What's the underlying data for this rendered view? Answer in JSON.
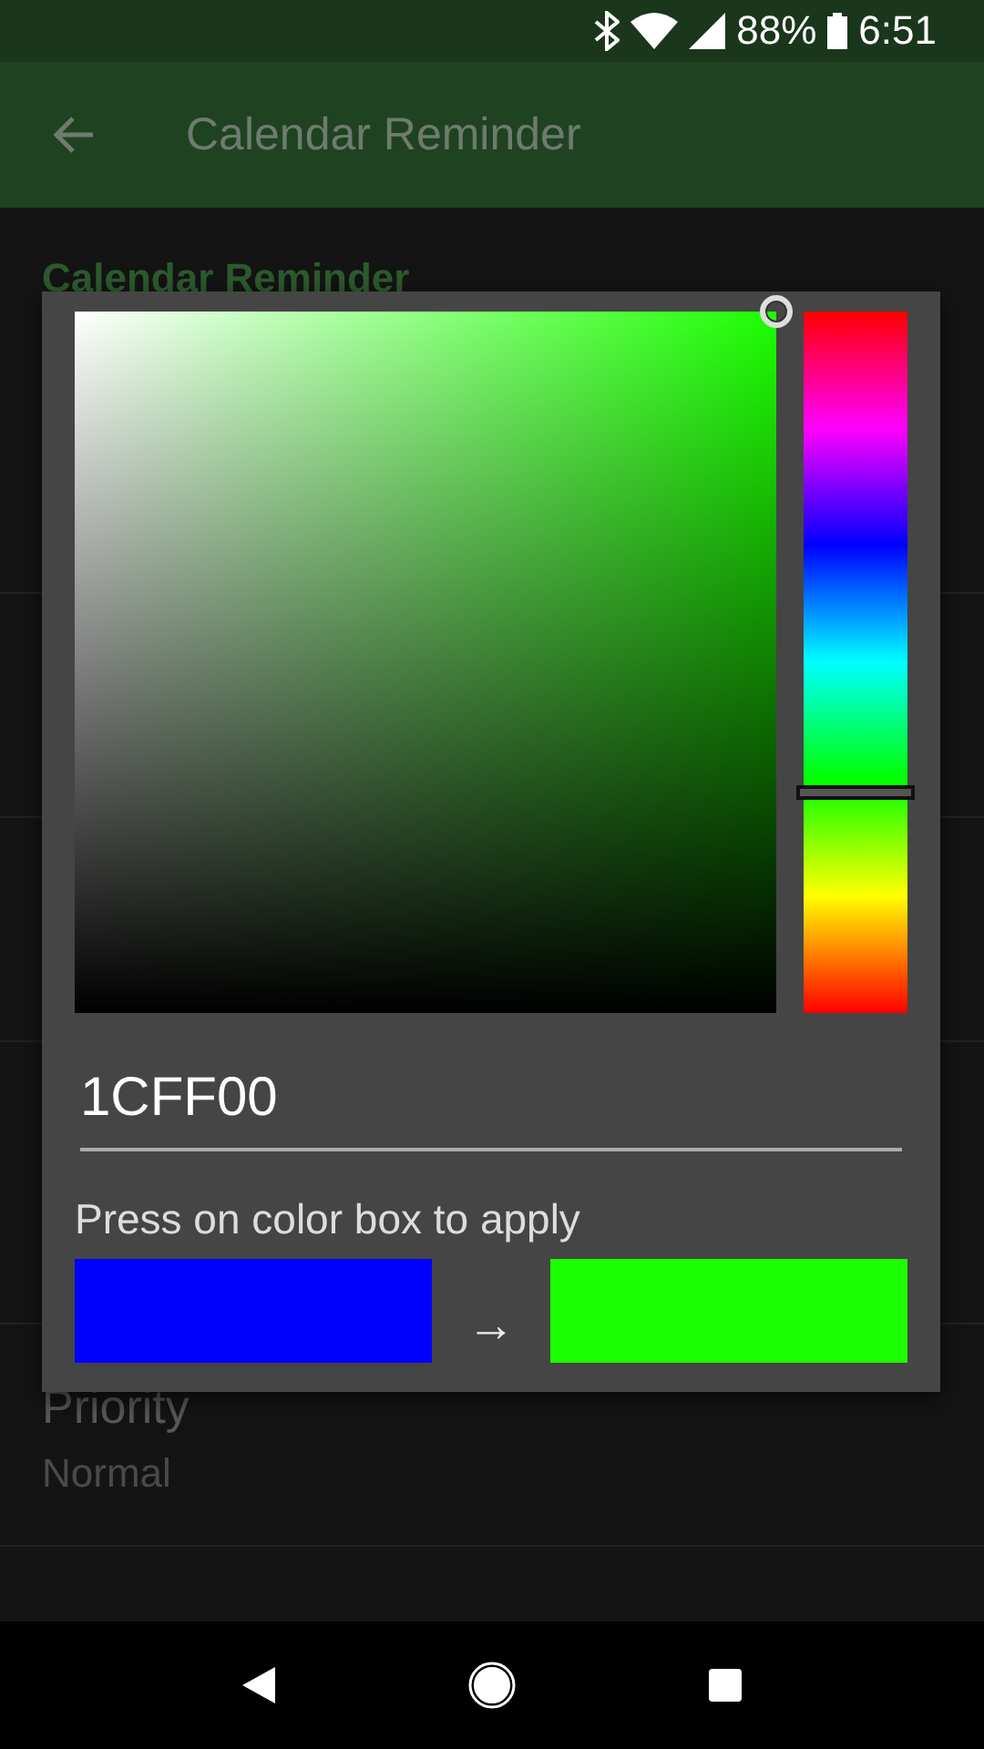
{
  "status_bar": {
    "battery": "88%",
    "time": "6:51"
  },
  "app_bar": {
    "title": "Calendar Reminder"
  },
  "settings": {
    "header": "Calendar Reminder",
    "rows": [
      {
        "title": "",
        "value": ""
      },
      {
        "title": "",
        "value": ""
      },
      {
        "title": "",
        "value": ""
      },
      {
        "title": "Priority",
        "value": "Normal"
      }
    ]
  },
  "color_dialog": {
    "hex_input": {
      "value": "1CFF00"
    },
    "hint": "Press on color box to apply",
    "swatches": [
      {
        "color": "#0000ff"
      },
      {
        "color": "#1cff00"
      }
    ],
    "arrow": "→"
  }
}
